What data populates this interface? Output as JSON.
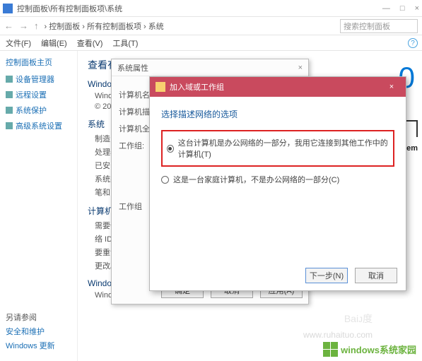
{
  "titlebar": {
    "title": "控制面板\\所有控制面板项\\系统"
  },
  "winbtns": {
    "min": "—",
    "max": "□",
    "close": "×"
  },
  "navbar": {
    "back": "←",
    "fwd": "→",
    "up": "↑",
    "breadcrumb": "› 控制面板 › 所有控制面板项 › 系统",
    "search_placeholder": "搜索控制面板"
  },
  "menubar": [
    "文件(F)",
    "编辑(E)",
    "查看(V)",
    "工具(T)"
  ],
  "sidebar": {
    "home": "控制面板主页",
    "items": [
      {
        "label": "设备管理器"
      },
      {
        "label": "远程设置"
      },
      {
        "label": "系统保护"
      },
      {
        "label": "高级系统设置"
      }
    ]
  },
  "seealso": {
    "header": "另请参阅",
    "links": [
      "安全和维护",
      "Windows 更新"
    ]
  },
  "main": {
    "heading": "查看有关计算机的基本信息",
    "sec1": "Windows",
    "sec1_line1": "Windows",
    "sec1_line2": "© 201",
    "sec2": "系统",
    "sec2_rows": [
      {
        "lab": "制造",
        "val": ""
      },
      {
        "lab": "处理器",
        "val": ""
      },
      {
        "lab": "已安",
        "val": ""
      },
      {
        "lab": "系统类",
        "val": ""
      },
      {
        "lab": "笔和",
        "val": ""
      }
    ],
    "sec3": "计算机",
    "sec3_rows": [
      {
        "lab": "需要使用",
        "val": ""
      },
      {
        "lab": "络 ID。",
        "val": ""
      }
    ],
    "sec3b_rows": [
      {
        "lab": "要重命名",
        "val": ""
      },
      {
        "lab": "更改。",
        "val": ""
      }
    ],
    "sec4": "Windows",
    "sec4_line": "Windows",
    "ten": "0",
    "tem": "tem"
  },
  "dlg1": {
    "title": "系统属性",
    "lab1": "计算机名",
    "lab2": "计算机描",
    "lab3": "计算机全",
    "lab4": "工作组:",
    "lab5": "工作组",
    "btns": {
      "ok": "确定",
      "cancel": "取消",
      "apply": "应用(A)"
    }
  },
  "dlg2": {
    "title": "加入域或工作组",
    "prompt": "选择描述网络的选项",
    "opt1": "这台计算机是办公网络的一部分，我用它连接到其他工作中的计算机(T)",
    "opt2": "这是一台家庭计算机，不是办公网络的一部分(C)",
    "btns": {
      "next": "下一步(N)",
      "cancel": "取消"
    }
  },
  "logo": {
    "text": "windows系统家园"
  },
  "ruhaituo": "www.ruhaituo.com",
  "help": "?"
}
